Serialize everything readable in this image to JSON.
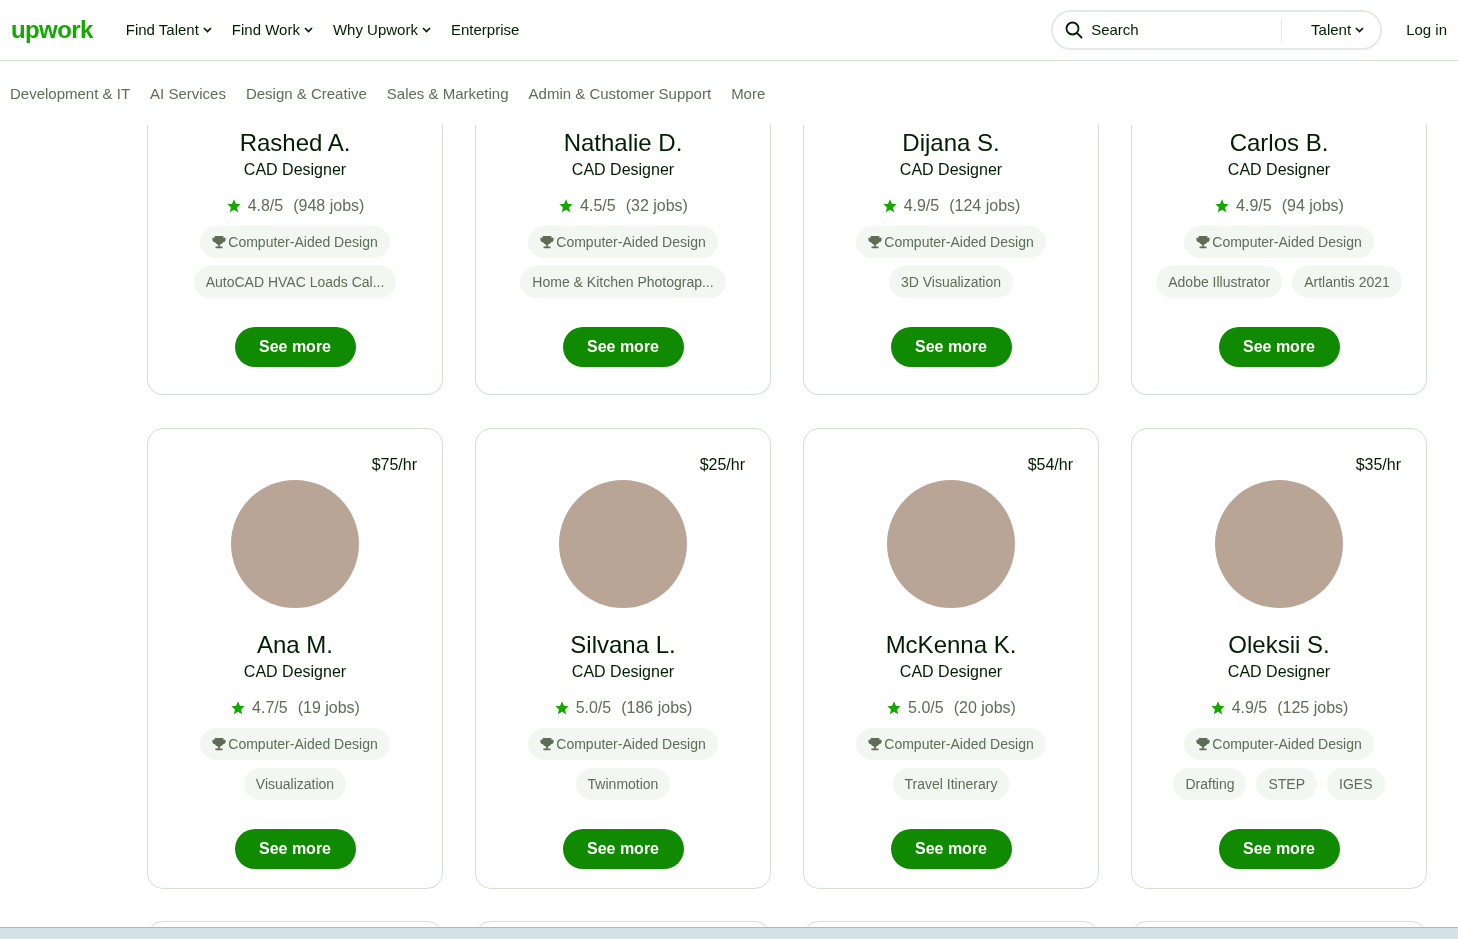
{
  "logo": "upwork",
  "nav": [
    {
      "label": "Find Talent",
      "dropdown": true
    },
    {
      "label": "Find Work",
      "dropdown": true
    },
    {
      "label": "Why Upwork",
      "dropdown": true
    },
    {
      "label": "Enterprise",
      "dropdown": false
    }
  ],
  "search": {
    "placeholder": "Search",
    "scope": "Talent"
  },
  "login": "Log in",
  "categories": [
    "Development & IT",
    "AI Services",
    "Design & Creative",
    "Sales & Marketing",
    "Admin & Customer Support",
    "More"
  ],
  "card_rows": [
    {
      "cut_top": true,
      "cards": [
        {
          "name": "Rashed A.",
          "title": "CAD Designer",
          "rating": "4.8/5",
          "jobs": "(948 jobs)",
          "skills": [
            {
              "label": "Computer-Aided Design",
              "kind": "top"
            },
            {
              "label": "AutoCAD HVAC Loads Cal...",
              "kind": "plain"
            }
          ],
          "button": "See more"
        },
        {
          "name": "Nathalie D.",
          "title": "CAD Designer",
          "rating": "4.5/5",
          "jobs": "(32 jobs)",
          "skills": [
            {
              "label": "Computer-Aided Design",
              "kind": "top"
            },
            {
              "label": "Home & Kitchen Photograp...",
              "kind": "plain"
            }
          ],
          "button": "See more"
        },
        {
          "name": "Dijana S.",
          "title": "CAD Designer",
          "rating": "4.9/5",
          "jobs": "(124 jobs)",
          "skills": [
            {
              "label": "Computer-Aided Design",
              "kind": "top"
            },
            {
              "label": "3D Visualization",
              "kind": "plain"
            }
          ],
          "button": "See more"
        },
        {
          "name": "Carlos B.",
          "title": "CAD Designer",
          "rating": "4.9/5",
          "jobs": "(94 jobs)",
          "skills": [
            {
              "label": "Computer-Aided Design",
              "kind": "top"
            },
            {
              "label": "Adobe Illustrator",
              "kind": "plain"
            },
            {
              "label": "Artlantis 2021",
              "kind": "plain"
            }
          ],
          "button": "See more"
        }
      ]
    },
    {
      "cut_top": false,
      "cards": [
        {
          "rate": "$75/hr",
          "name": "Ana M.",
          "title": "CAD Designer",
          "rating": "4.7/5",
          "jobs": "(19 jobs)",
          "skills": [
            {
              "label": "Computer-Aided Design",
              "kind": "top"
            },
            {
              "label": "Visualization",
              "kind": "plain"
            }
          ],
          "button": "See more"
        },
        {
          "rate": "$25/hr",
          "name": "Silvana L.",
          "title": "CAD Designer",
          "rating": "5.0/5",
          "jobs": "(186 jobs)",
          "skills": [
            {
              "label": "Computer-Aided Design",
              "kind": "top"
            },
            {
              "label": "Twinmotion",
              "kind": "plain"
            }
          ],
          "button": "See more"
        },
        {
          "rate": "$54/hr",
          "name": "McKenna K.",
          "title": "CAD Designer",
          "rating": "5.0/5",
          "jobs": "(20 jobs)",
          "skills": [
            {
              "label": "Computer-Aided Design",
              "kind": "top"
            },
            {
              "label": "Travel Itinerary",
              "kind": "plain"
            }
          ],
          "button": "See more"
        },
        {
          "rate": "$35/hr",
          "name": "Oleksii S.",
          "title": "CAD Designer",
          "rating": "4.9/5",
          "jobs": "(125 jobs)",
          "skills": [
            {
              "label": "Computer-Aided Design",
              "kind": "top"
            },
            {
              "label": "Drafting",
              "kind": "plain"
            },
            {
              "label": "STEP",
              "kind": "plain"
            },
            {
              "label": "IGES",
              "kind": "plain"
            }
          ],
          "button": "See more"
        }
      ]
    }
  ]
}
